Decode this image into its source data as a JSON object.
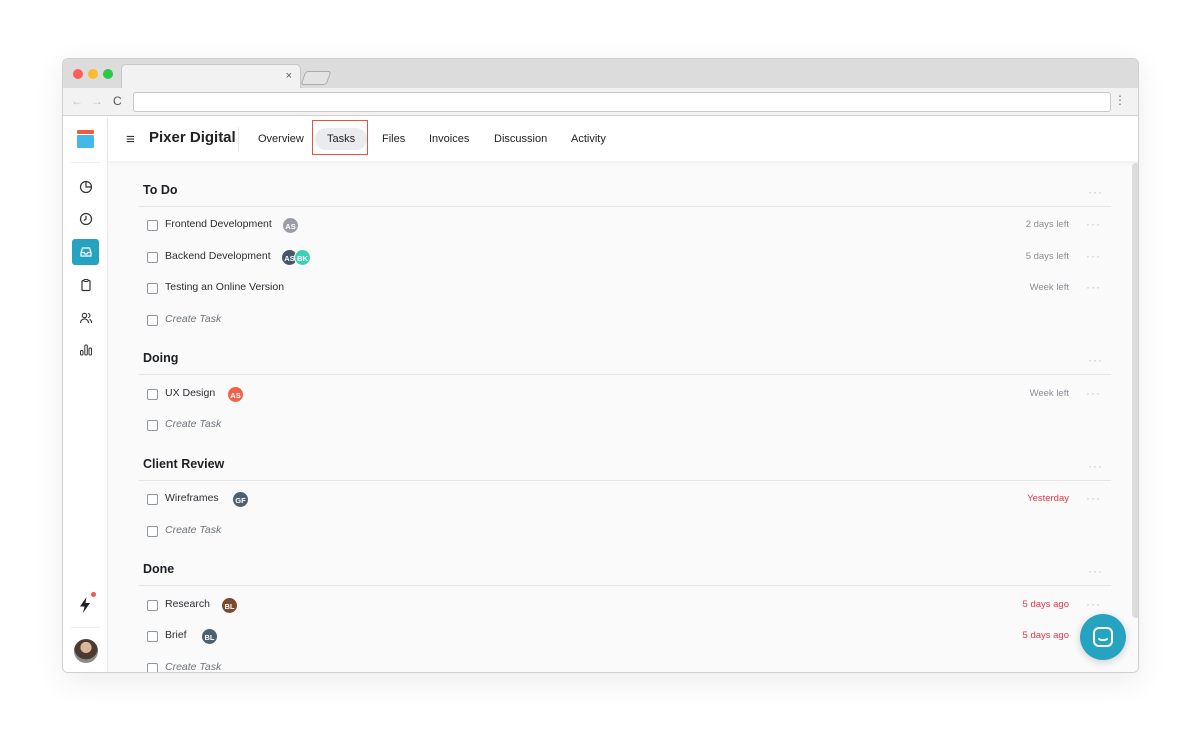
{
  "browser": {
    "tab_close": "×",
    "url": "",
    "nav_back": "←",
    "nav_forward": "→",
    "nav_reload": "C",
    "menu": "⋮"
  },
  "header": {
    "menu_glyph": "≡",
    "title": "Pixer Digital",
    "tabs": [
      {
        "label": "Overview",
        "active": false
      },
      {
        "label": "Tasks",
        "active": true
      },
      {
        "label": "Files",
        "active": false
      },
      {
        "label": "Invoices",
        "active": false
      },
      {
        "label": "Discussion",
        "active": false
      },
      {
        "label": "Activity",
        "active": false
      }
    ]
  },
  "sidebar": {
    "items": [
      {
        "icon": "pie-chart-icon",
        "active": false
      },
      {
        "icon": "clock-icon",
        "active": false
      },
      {
        "icon": "inbox-icon",
        "active": true
      },
      {
        "icon": "clipboard-icon",
        "active": false
      },
      {
        "icon": "users-icon",
        "active": false
      },
      {
        "icon": "bar-chart-icon",
        "active": false
      }
    ],
    "bottom": [
      "bolt-icon",
      "user-avatar"
    ]
  },
  "colors": {
    "accent": "#27a3c2",
    "danger": "#e5364a",
    "highlight": "#e5533f"
  },
  "sections": [
    {
      "title": "To Do",
      "more": "···",
      "tasks": [
        {
          "name": "Frontend Development",
          "assignees": [
            {
              "initials": "AS",
              "color": "#9a9ea4"
            }
          ],
          "due": "2 days left",
          "overdue": false
        },
        {
          "name": "Backend Development",
          "assignees": [
            {
              "initials": "AS",
              "color": "#4a5565"
            },
            {
              "initials": "BK",
              "color": "#3fd0b4"
            }
          ],
          "due": "5 days left",
          "overdue": false
        },
        {
          "name": "Testing an Online Version",
          "assignees": [],
          "due": "Week left",
          "overdue": false
        }
      ],
      "create_label": "Create Task"
    },
    {
      "title": "Doing",
      "more": "···",
      "tasks": [
        {
          "name": "UX Design",
          "assignees": [
            {
              "initials": "AS",
              "color": "#f0614a"
            }
          ],
          "due": "Week left",
          "overdue": false
        }
      ],
      "create_label": "Create Task"
    },
    {
      "title": "Client Review",
      "more": "···",
      "tasks": [
        {
          "name": "Wireframes",
          "assignees": [
            {
              "initials": "GF",
              "color": "#4e5f6e"
            }
          ],
          "due": "Yesterday",
          "overdue": true
        }
      ],
      "create_label": "Create Task"
    },
    {
      "title": "Done",
      "more": "···",
      "tasks": [
        {
          "name": "Research",
          "assignees": [
            {
              "initials": "BL",
              "color": "#7a4a2e"
            }
          ],
          "due": "5 days ago",
          "overdue": true
        },
        {
          "name": "Brief",
          "assignees": [
            {
              "initials": "BL",
              "color": "#4e5f6e"
            }
          ],
          "due": "5 days ago",
          "overdue": true
        }
      ],
      "create_label": "Create Task"
    }
  ]
}
